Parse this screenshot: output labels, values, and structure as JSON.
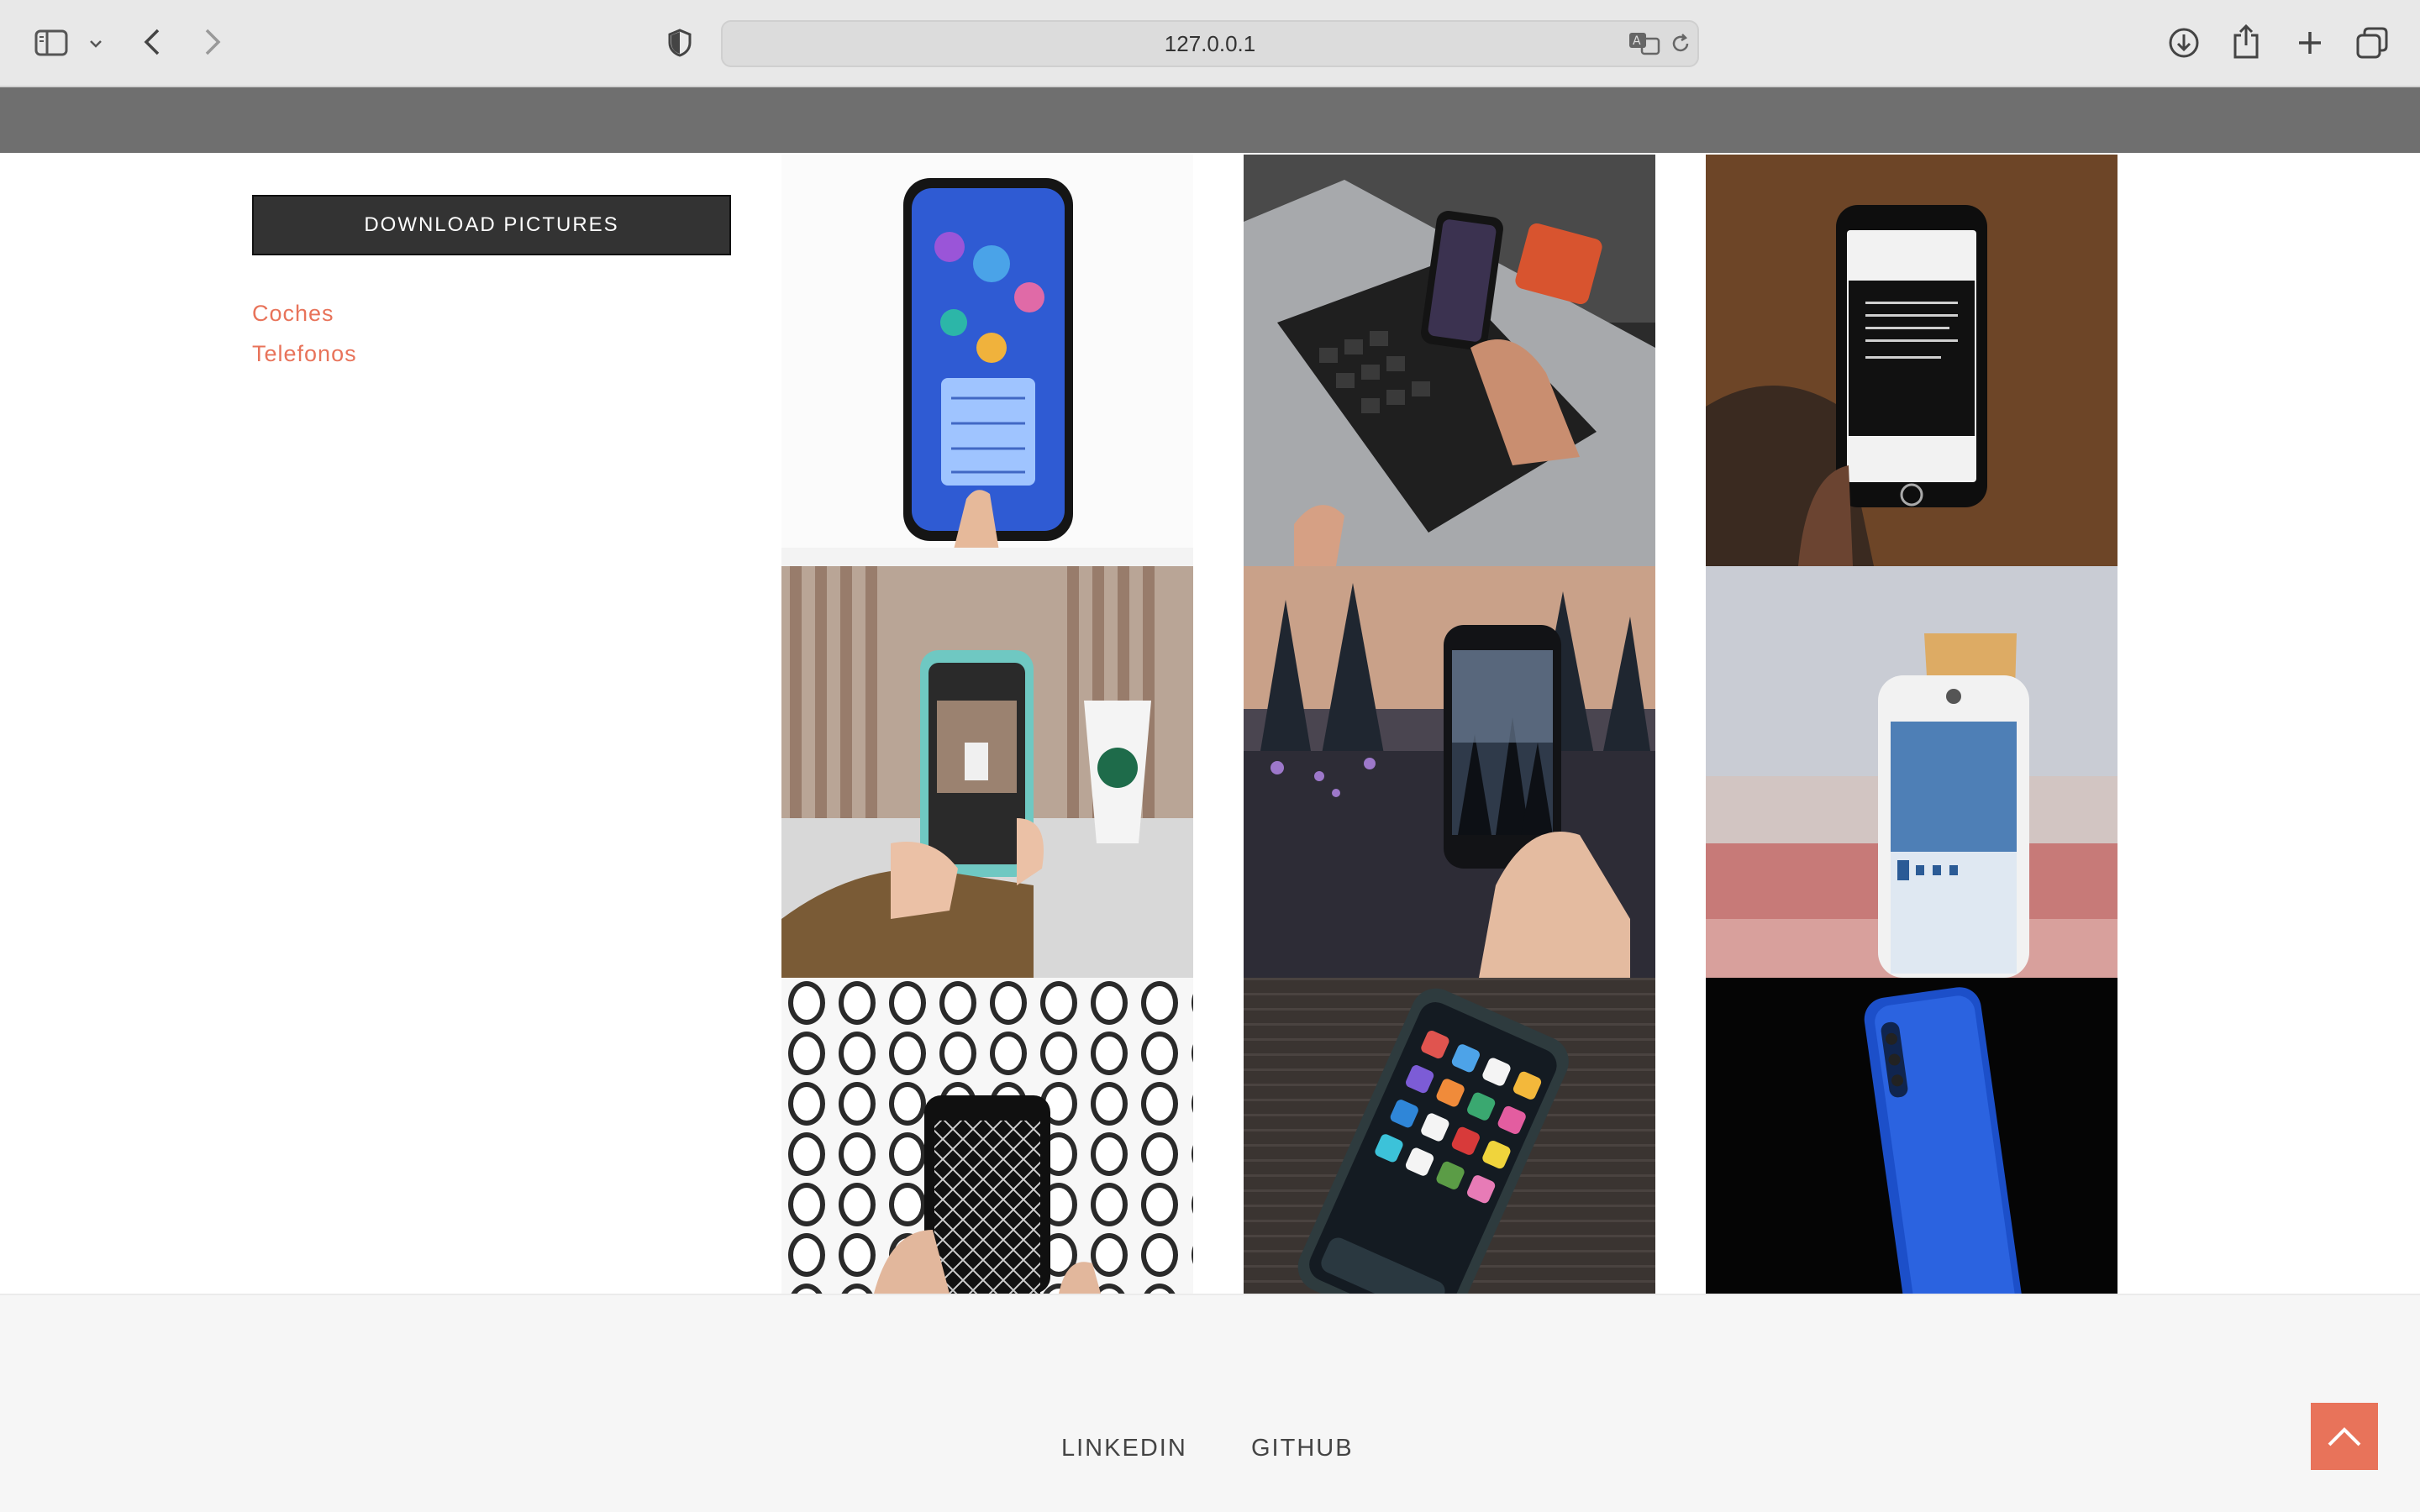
{
  "browser": {
    "url": "127.0.0.1",
    "icons": [
      "sidebar-icon",
      "chevron-down-icon",
      "back-icon",
      "forward-icon",
      "shield-icon",
      "translate-icon",
      "reload-icon",
      "download-icon",
      "share-icon",
      "new-tab-icon",
      "tab-overview-icon"
    ]
  },
  "sidebar": {
    "download_label": "DOWNLOAD PICTURES",
    "categories": [
      {
        "label": "Coches"
      },
      {
        "label": "Telefonos"
      }
    ]
  },
  "gallery": {
    "images": [
      {
        "subject": "phone-menu-hand"
      },
      {
        "subject": "laptop-phone-hands"
      },
      {
        "subject": "phone-instagram-hand"
      },
      {
        "subject": "phone-photo-coffee"
      },
      {
        "subject": "phone-photo-trees"
      },
      {
        "subject": "phone-weather-beer"
      },
      {
        "subject": "phone-mesh-pattern"
      },
      {
        "subject": "phone-on-table"
      },
      {
        "subject": "blue-phone-back"
      }
    ]
  },
  "footer": {
    "links": [
      {
        "label": "LINKEDIN"
      },
      {
        "label": "GITHUB"
      }
    ],
    "back_to_top_icon": "chevron-up-icon"
  },
  "colors": {
    "accent": "#e8735a",
    "button": "#333333",
    "header_band": "#6f6f6f"
  }
}
